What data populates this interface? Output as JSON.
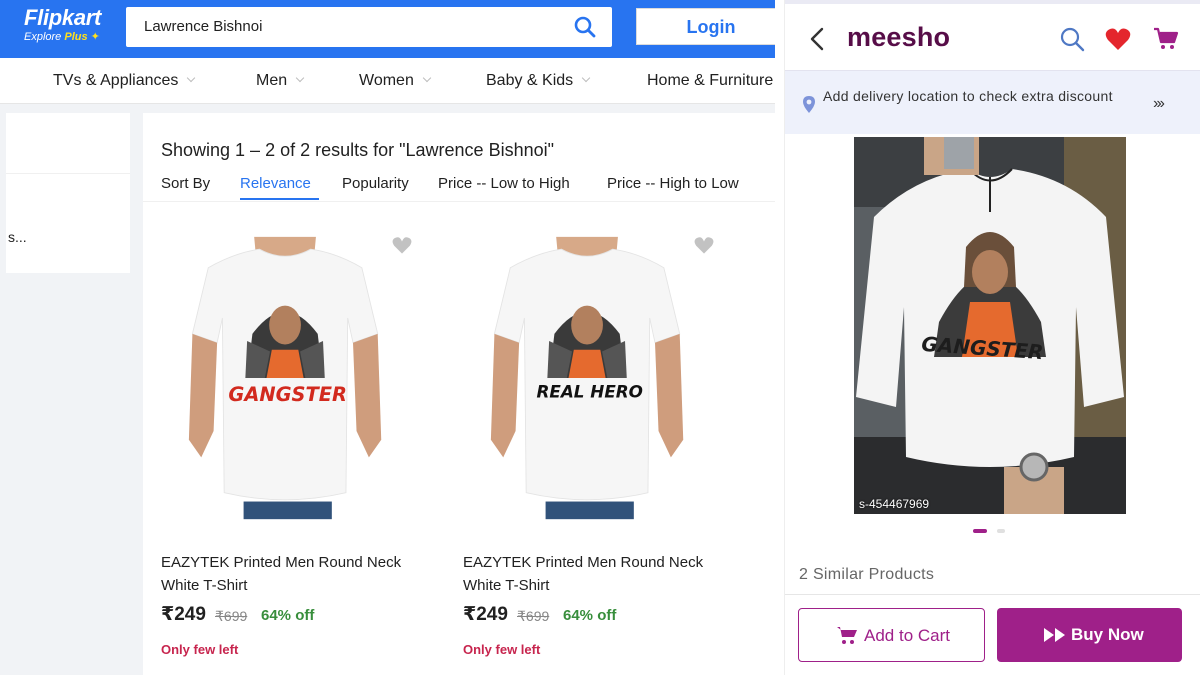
{
  "flipkart": {
    "logo": {
      "brand": "Flipkart",
      "tagline_prefix": "Explore ",
      "tagline_plus": "Plus"
    },
    "search": {
      "value": "Lawrence Bishnoi",
      "icon": "search-icon"
    },
    "login_label": "Login",
    "categories": [
      "TVs & Appliances",
      "Men",
      "Women",
      "Baby & Kids",
      "Home & Furniture"
    ],
    "filter_truncated_text": "s...",
    "showing_text": "Showing 1 – 2 of 2 results for \"Lawrence Bishnoi\"",
    "sort_by_label": "Sort By",
    "sort_options": [
      "Relevance",
      "Popularity",
      "Price -- Low to High",
      "Price -- High to Low"
    ],
    "active_sort": "Relevance",
    "products": [
      {
        "print_text": "GANGSTER",
        "title_line1": "EAZYTEK Printed Men Round Neck",
        "title_line2": "White T-Shirt",
        "price": "₹249",
        "mrp": "₹699",
        "discount": "64% off",
        "stock": "Only few left"
      },
      {
        "print_text": "REAL HERO",
        "title_line1": "EAZYTEK Printed Men Round Neck",
        "title_line2": "White T-Shirt",
        "price": "₹249",
        "mrp": "₹699",
        "discount": "64% off",
        "stock": "Only few left"
      }
    ],
    "colors": {
      "brand_blue": "#2874f0",
      "discount_green": "#388e3c",
      "stock_red": "#c7254e"
    }
  },
  "meesho": {
    "logo": "meesho",
    "delivery_text": "Add delivery location to check extra discount",
    "product_print_text": "GANGSTER",
    "sku": "s-454467969",
    "similar_products": "2 Similar Products",
    "add_to_cart_label": "Add to Cart",
    "buy_now_label": "Buy Now",
    "colors": {
      "brand": "#570d48",
      "accent": "#9f2089"
    }
  }
}
